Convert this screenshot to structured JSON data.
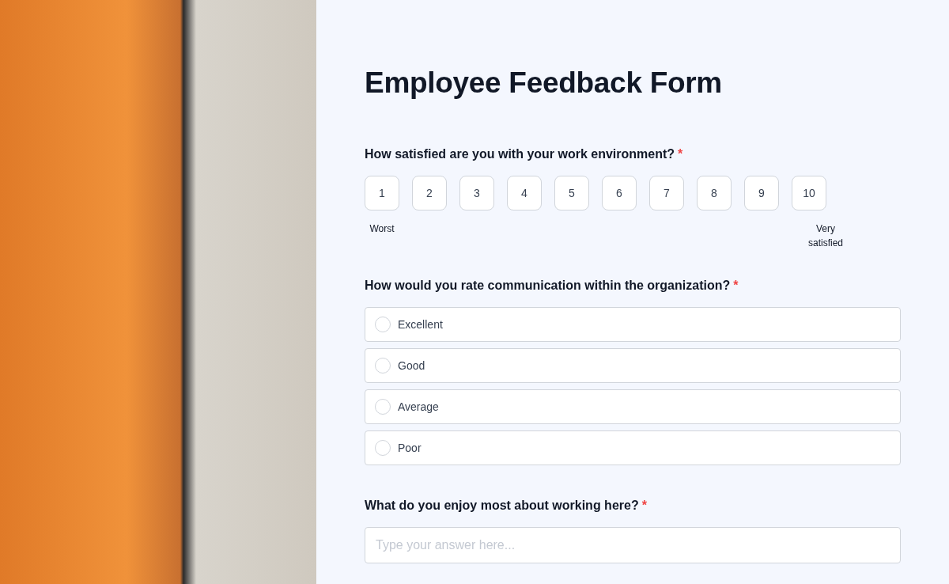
{
  "form": {
    "title": "Employee Feedback Form",
    "questions": [
      {
        "kind": "scale",
        "label": "How satisfied are you with your work environment?",
        "required_mark": "*",
        "options": [
          {
            "label": "1",
            "selected": false
          },
          {
            "label": "2",
            "selected": false
          },
          {
            "label": "3",
            "selected": false
          },
          {
            "label": "4",
            "selected": false
          },
          {
            "label": "5",
            "selected": false
          },
          {
            "label": "6",
            "selected": false
          },
          {
            "label": "7",
            "selected": false
          },
          {
            "label": "8",
            "selected": false
          },
          {
            "label": "9",
            "selected": false
          },
          {
            "label": "10",
            "selected": false
          }
        ],
        "min_label": "Worst",
        "max_label": "Very satisfied"
      },
      {
        "kind": "radio",
        "label": "How would you rate communication within the organization?",
        "required_mark": "*",
        "options": [
          {
            "label": "Excellent",
            "selected": false
          },
          {
            "label": "Good",
            "selected": false
          },
          {
            "label": "Average",
            "selected": false
          },
          {
            "label": "Poor",
            "selected": false
          }
        ]
      },
      {
        "kind": "text",
        "label": "What do you enjoy most about working here?",
        "required_mark": "*",
        "placeholder": "Type your answer here..."
      }
    ]
  }
}
